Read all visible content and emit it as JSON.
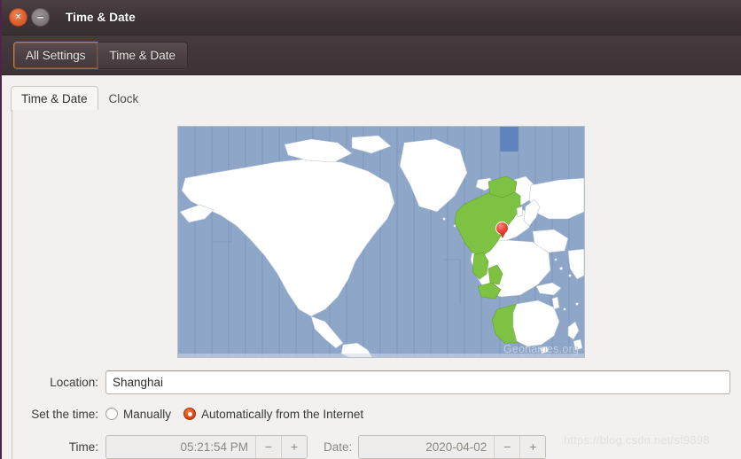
{
  "window": {
    "title": "Time & Date",
    "close_icon": "close-icon",
    "minimize_icon": "minimize-icon",
    "close_glyph": "×",
    "minimize_glyph": "−"
  },
  "toolbar": {
    "all_settings_label": "All Settings",
    "current_panel_label": "Time & Date"
  },
  "tabs": [
    {
      "label": "Time & Date",
      "active": true
    },
    {
      "label": "Clock",
      "active": false
    }
  ],
  "map": {
    "attribution": "Geonames.org",
    "marker_icon": "location-marker-icon",
    "ocean_color": "#8ea6c8",
    "land_color": "#ffffff",
    "highlight_color": "#7dc242",
    "selected_zone_color": "#5f83bd",
    "marker_color": "#dd4814"
  },
  "location": {
    "label": "Location:",
    "value": "Shanghai",
    "placeholder": ""
  },
  "set_time": {
    "label": "Set the time:",
    "options": [
      {
        "label": "Manually",
        "selected": false
      },
      {
        "label": "Automatically from the Internet",
        "selected": true
      }
    ]
  },
  "time_field": {
    "label": "Time:",
    "value": "05:21:54 PM",
    "minus_label": "−",
    "plus_label": "+"
  },
  "date_field": {
    "label": "Date:",
    "value": "2020-04-02",
    "minus_label": "−",
    "plus_label": "+"
  },
  "watermark": {
    "text": "https://blog.csdn.net/sf9898"
  },
  "colors": {
    "accent": "#dd4814",
    "titlebar": "#3d3336",
    "panel_bg": "#f2f1f0"
  }
}
